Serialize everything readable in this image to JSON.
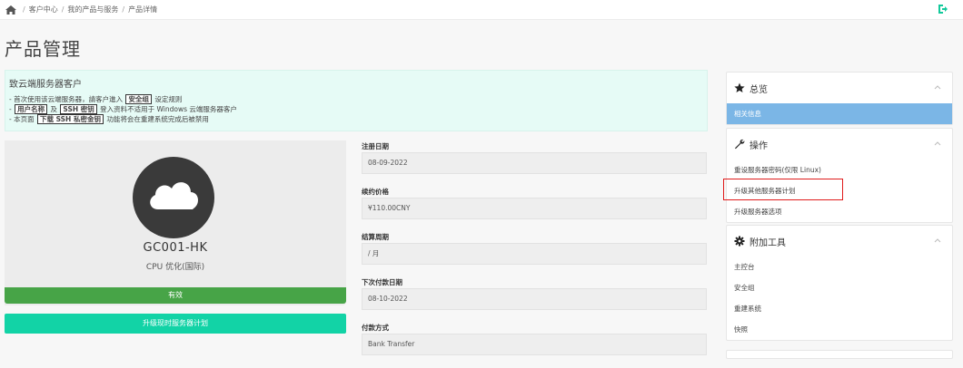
{
  "breadcrumb": {
    "items": [
      "客户中心",
      "我的产品与服务",
      "产品详情"
    ]
  },
  "page": {
    "title": "产品管理"
  },
  "notice": {
    "title": "致云端服务器客户",
    "line1": {
      "pre": "- 首次使用该云端服务器，請客户進入",
      "tag": "安全组",
      "post": "设定规则"
    },
    "line2": {
      "pre": "-",
      "tag1": "用户名称",
      "mid": "及",
      "tag2": "SSH 密钥",
      "post": "登入资料不适用于 Windows 云端服务器客户"
    },
    "line3": {
      "pre": "- 本页面",
      "tag": "下载 SSH 私密金钥",
      "post": "功能将会在重建系统完成后被禁用"
    }
  },
  "product": {
    "name": "GC001-HK",
    "group": "CPU 优化(国际)",
    "status": "有效",
    "upgrade_button": "升级现时服务器计划"
  },
  "fields": [
    {
      "label": "注册日期",
      "value": "08-09-2022"
    },
    {
      "label": "续约价格",
      "value": "¥110.00CNY"
    },
    {
      "label": "结算周期",
      "value": "/ 月"
    },
    {
      "label": "下次付款日期",
      "value": "08-10-2022"
    },
    {
      "label": "付款方式",
      "value": "Bank Transfer"
    }
  ],
  "sidebar": {
    "overview": {
      "title": "总览",
      "items": [
        "相关信息"
      ]
    },
    "actions": {
      "title": "操作",
      "items": [
        "重设服务器密码(仅限 Linux)",
        "升级其他服务器计划",
        "升级服务器选项"
      ]
    },
    "tools": {
      "title": "附加工具",
      "items": [
        "主控台",
        "安全组",
        "重建系统",
        "快照"
      ]
    }
  },
  "colors": {
    "notice_bg": "#e6fbf6",
    "status_green": "#47a447",
    "upgrade_teal": "#12d3a6",
    "active_blue": "#7bb6e6",
    "highlight_red": "#e01b1b"
  }
}
